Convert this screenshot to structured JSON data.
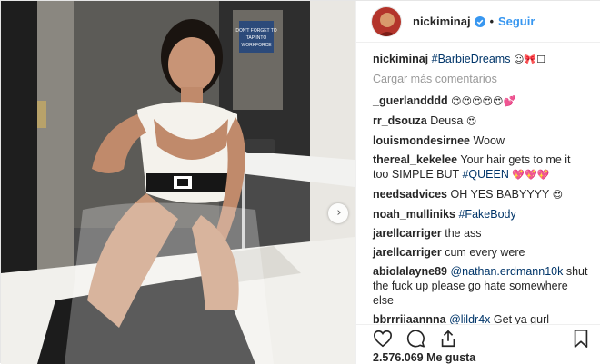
{
  "photo": {
    "sign_text": "DON'T FORGET TO TAP INTO WORKFORCE"
  },
  "header": {
    "username": "nickiminaj",
    "separator": "•",
    "follow_label": "Seguir"
  },
  "comments": {
    "caption": {
      "user": "nickiminaj",
      "tag": "#BarbieDreams",
      "emoji": "☺🎀☐"
    },
    "load_more": "Cargar más comentarios",
    "items": [
      {
        "user": "_guerlandddd",
        "text": "",
        "emoji": "😍😍😍😍😍💕"
      },
      {
        "user": "rr_dsouza",
        "text": "Deusa",
        "emoji": "😍"
      },
      {
        "user": "louismondesirnee",
        "text": "Woow",
        "emoji": ""
      },
      {
        "user": "thereal_kekelee",
        "text": "Your hair gets to me it too SIMPLE BUT",
        "tag": "#QUEEN",
        "emoji": "💖💖💖"
      },
      {
        "user": "needsadvices",
        "text": "OH YES BABYYYY",
        "emoji": "😍"
      },
      {
        "user": "noah_mulliniks",
        "text": "",
        "tag": "#FakeBody",
        "emoji": ""
      },
      {
        "user": "jarellcarriger",
        "text": "the ass",
        "emoji": ""
      },
      {
        "user": "jarellcarriger",
        "text": "cum every were",
        "emoji": ""
      },
      {
        "user": "abiolalayne89",
        "mention": "@nathan.erdmann10k",
        "text": "shut the fuck up please go hate somewhere else",
        "emoji": ""
      },
      {
        "user": "bbrrriiaannna",
        "mention": "@lildr4x",
        "text": "Get ya gurl",
        "emoji": ""
      }
    ]
  },
  "actions": {
    "like_icon": "heart-icon",
    "comment_icon": "comment-bubble-icon",
    "share_icon": "share-icon",
    "save_icon": "bookmark-icon"
  },
  "likes_text": "2.576.069 Me gusta",
  "colors": {
    "link": "#3897f0",
    "hashtag": "#003569",
    "muted": "#999999"
  }
}
